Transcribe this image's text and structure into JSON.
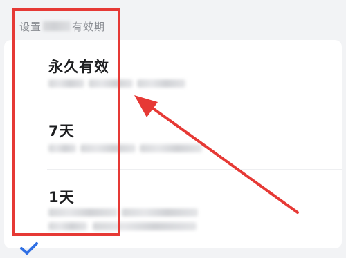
{
  "section": {
    "title_prefix": "设置",
    "title_suffix": "有效期"
  },
  "options": [
    {
      "label": "永久有效",
      "selected": false
    },
    {
      "label": "7天",
      "selected": false
    },
    {
      "label": "1天",
      "selected": true
    }
  ],
  "colors": {
    "accent": "#2f6fe4",
    "annotation": "#e63935",
    "background": "#f2f3f5",
    "card": "#ffffff"
  },
  "icons": {
    "selected": "checkmark-icon"
  }
}
